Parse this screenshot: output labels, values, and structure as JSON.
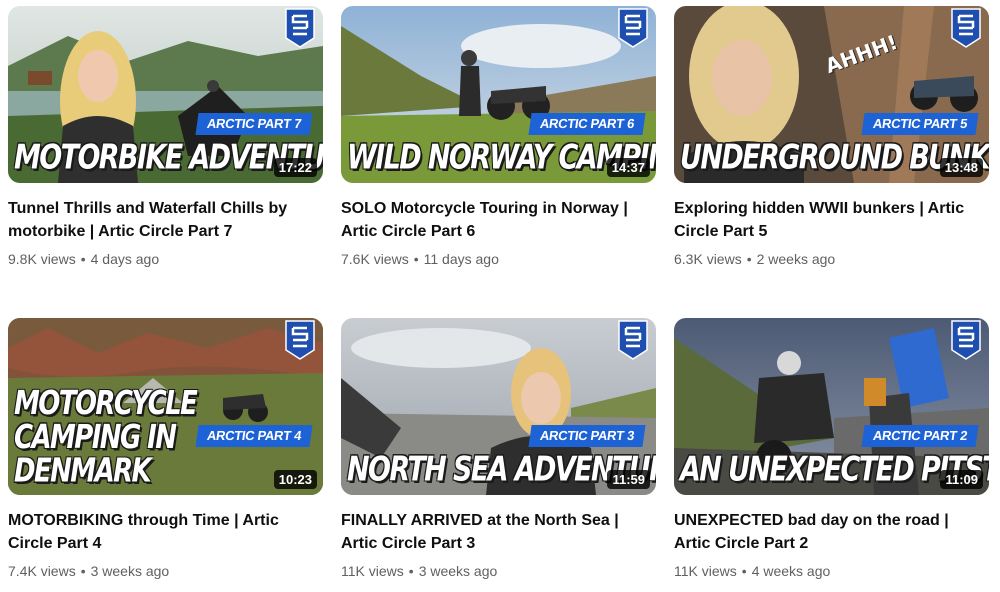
{
  "videos": [
    {
      "title": "Tunnel Thrills and Waterfall Chills by motorbike | Artic Circle Part 7",
      "views": "9.8K views",
      "age": "4 days ago",
      "duration": "17:22",
      "part_tag": "ARCTIC PART 7",
      "overlay": "MOTORBIKE ADVENTURE"
    },
    {
      "title": "SOLO Motorcycle Touring in Norway | Artic Circle Part 6",
      "views": "7.6K views",
      "age": "11 days ago",
      "duration": "14:37",
      "part_tag": "ARCTIC PART 6",
      "overlay": "WILD NORWAY CAMPING"
    },
    {
      "title": "Exploring hidden WWII bunkers | Artic Circle Part 5",
      "views": "6.3K views",
      "age": "2 weeks ago",
      "duration": "13:48",
      "part_tag": "ARCTIC PART 5",
      "overlay": "UNDERGROUND BUNKERS",
      "exclaim": "AHHH!"
    },
    {
      "title": "MOTORBIKING through Time | Artic Circle Part 4",
      "views": "7.4K views",
      "age": "3 weeks ago",
      "duration": "10:23",
      "part_tag": "ARCTIC PART 4",
      "overlay_line1": "MOTORCYCLE",
      "overlay_line2": "CAMPING IN DENMARK"
    },
    {
      "title": "FINALLY ARRIVED at the North Sea | Artic Circle Part 3",
      "views": "11K views",
      "age": "3 weeks ago",
      "duration": "11:59",
      "part_tag": "ARCTIC PART 3",
      "overlay": "NORTH SEA ADVENTURE"
    },
    {
      "title": "UNEXPECTED bad day on the road | Artic Circle Part 2",
      "views": "11K views",
      "age": "4 weeks ago",
      "duration": "11:09",
      "part_tag": "ARCTIC PART 2",
      "overlay": "AN UNEXPECTED PITSTOP"
    }
  ],
  "separator": "•",
  "colors": {
    "part_tag_bg": "#1d63d6",
    "logo_bg": "#1e4fb0",
    "duration_bg": "#000000",
    "meta_text": "#606060"
  }
}
